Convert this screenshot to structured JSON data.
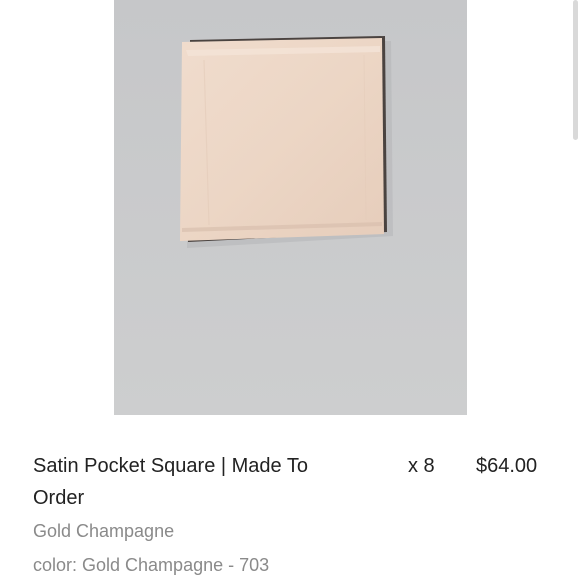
{
  "product_image": {
    "alt": "Satin Pocket Square",
    "background_color": "#c8c9cb",
    "fabric_color": "#efd9c9"
  },
  "line_item": {
    "title": "Satin Pocket Square | Made To Order",
    "quantity": "x 8",
    "price": "$64.00",
    "variant": "Gold Champagne",
    "option": "color: Gold Champagne - 703"
  }
}
